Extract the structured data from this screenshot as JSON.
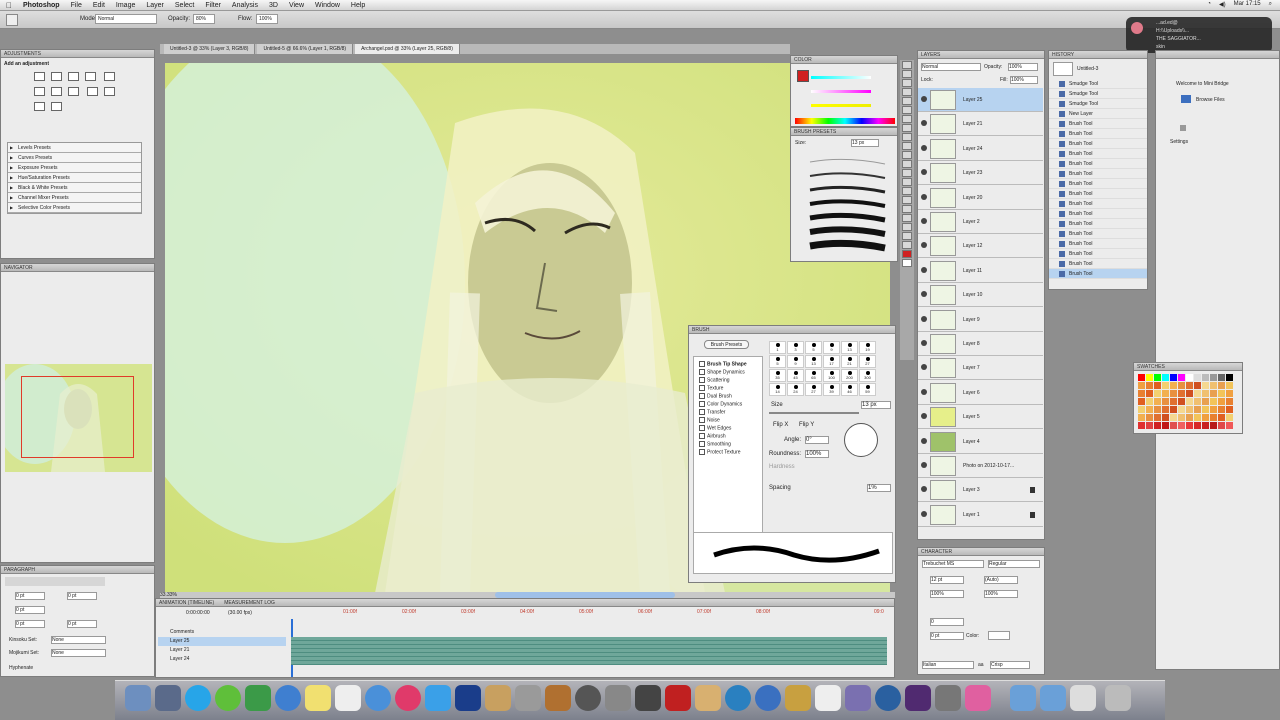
{
  "menubar": {
    "app": "Photoshop",
    "items": [
      "File",
      "Edit",
      "Image",
      "Layer",
      "Select",
      "Filter",
      "Analysis",
      "3D",
      "View",
      "Window",
      "Help"
    ],
    "clock": "Mar 17:15"
  },
  "options": {
    "mode_label": "Mode:",
    "mode_value": "Normal",
    "opacity_label": "Opacity:",
    "opacity_value": "80%",
    "flow_label": "Flow:",
    "flow_value": "100%"
  },
  "doc_tabs": [
    "Untitled-3 @ 33% (Layer 3, RGB/8)",
    "Untitled-5 @ 66.6% (Layer 1, RGB/8)",
    "Archangel.psd @ 33% (Layer 25, RGB/8)"
  ],
  "adjustments": {
    "title": "ADJUSTMENTS",
    "heading": "Add an adjustment",
    "presets": [
      "Levels Presets",
      "Curves Presets",
      "Exposure Presets",
      "Hue/Saturation Presets",
      "Black & White Presets",
      "Channel Mixer Presets",
      "Selective Color Presets"
    ]
  },
  "navigator": {
    "title": "NAVIGATOR"
  },
  "paragraph": {
    "title": "PARAGRAPH",
    "indent_values": [
      "0 pt",
      "0 pt",
      "0 pt",
      "0 pt",
      "0 pt"
    ],
    "kinsoku_label": "Kinsoku Set:",
    "kinsoku_value": "None",
    "mojikumi_label": "Mojikumi Set:",
    "mojikumi_value": "None",
    "hyphenate": "Hyphenate"
  },
  "status": {
    "zoom": "33.33%"
  },
  "timeline": {
    "tabs": [
      "ANIMATION (TIMELINE)",
      "MEASUREMENT LOG"
    ],
    "timecode": "0:00:00:00",
    "fps": "(30.00 fps)",
    "ticks": [
      "01:00f",
      "02:00f",
      "03:00f",
      "04:00f",
      "05:00f",
      "06:00f",
      "07:00f",
      "08:00f",
      "09:0"
    ],
    "rows": [
      "Comments",
      "Layer 25",
      "Layer 21",
      "Layer 24"
    ]
  },
  "color_panel": {
    "title": "COLOR"
  },
  "brush_presets": {
    "title": "BRUSH PRESETS",
    "size_label": "Size:",
    "size_value": "13 px",
    "sizes": [
      "5",
      "9",
      "13",
      "17",
      "21",
      "27",
      "35",
      "45"
    ]
  },
  "brush": {
    "title": "BRUSH",
    "button": "Brush Presets",
    "options": [
      "Brush Tip Shape",
      "Shape Dynamics",
      "Scattering",
      "Texture",
      "Dual Brush",
      "Color Dynamics",
      "Transfer",
      "Noise",
      "Wet Edges",
      "Airbrush",
      "Smoothing",
      "Protect Texture"
    ],
    "size_label": "Size",
    "size_value": "13 px",
    "flip_x": "Flip X",
    "flip_y": "Flip Y",
    "angle_label": "Angle:",
    "angle_value": "0°",
    "roundness_label": "Roundness:",
    "roundness_value": "100%",
    "hardness_label": "Hardness",
    "spacing_label": "Spacing",
    "spacing_value": "1%",
    "tip_sizes": [
      "1",
      "3",
      "5",
      "9",
      "13",
      "19",
      "5",
      "9",
      "13",
      "17",
      "21",
      "27",
      "35",
      "45",
      "65",
      "100",
      "200",
      "300",
      "14",
      "24",
      "27",
      "39",
      "46",
      "59"
    ]
  },
  "layers": {
    "title": "LAYERS",
    "blend": "Normal",
    "opacity_label": "Opacity:",
    "opacity_value": "100%",
    "lock_label": "Lock:",
    "fill_label": "Fill:",
    "fill_value": "100%",
    "items": [
      "Layer 25",
      "Layer 21",
      "Layer 24",
      "Layer 23",
      "Layer 20",
      "Layer 2",
      "Layer 12",
      "Layer 11",
      "Layer 10",
      "Layer 9",
      "Layer 8",
      "Layer 7",
      "Layer 6",
      "Layer 5",
      "Layer 4",
      "Photo on 2012-10-17...",
      "Layer 3",
      "Layer 1"
    ]
  },
  "history": {
    "title": "HISTORY",
    "snapshot": "Untitled-3",
    "items": [
      "Smudge Tool",
      "Smudge Tool",
      "Smudge Tool",
      "New Layer",
      "Brush Tool",
      "Brush Tool",
      "Brush Tool",
      "Brush Tool",
      "Brush Tool",
      "Brush Tool",
      "Brush Tool",
      "Brush Tool",
      "Brush Tool",
      "Brush Tool",
      "Brush Tool",
      "Brush Tool",
      "Brush Tool",
      "Brush Tool",
      "Brush Tool",
      "Brush Tool"
    ]
  },
  "bridge": {
    "welcome": "Welcome to Mini Bridge",
    "browse": "Browse Files",
    "settings": "Settings"
  },
  "character": {
    "title": "CHARACTER",
    "font": "Trebuchet MS",
    "style": "Regular",
    "size": "12 pt",
    "leading": "(Auto)",
    "tracking": "0",
    "scale_v": "100%",
    "scale_h": "100%",
    "baseline": "0 pt",
    "color_label": "Color:",
    "language": "Italian",
    "aa_label": "aa",
    "aa_value": "Crisp"
  },
  "swatches": {
    "title": "SWATCHES"
  },
  "notification": {
    "line1": "...ad.ed@",
    "line2": "H:\\\\Uploads\\\\...",
    "line3": "THE SAGGIATOR...",
    "line4": "skin"
  }
}
